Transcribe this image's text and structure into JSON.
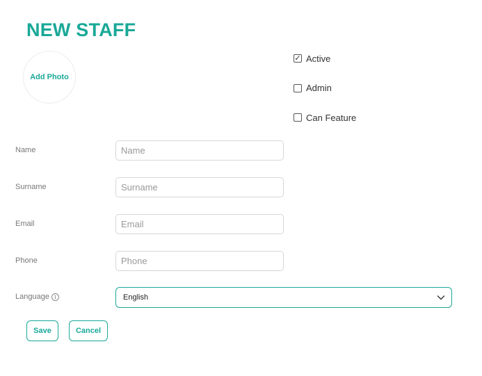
{
  "page": {
    "title": "NEW STAFF",
    "add_photo_label": "Add Photo"
  },
  "flags": [
    {
      "label": "Active",
      "checked": true,
      "mark": "✓"
    },
    {
      "label": "Admin",
      "checked": false,
      "mark": ""
    },
    {
      "label": "Can Feature",
      "checked": false,
      "mark": ""
    }
  ],
  "fields": {
    "name": {
      "label": "Name",
      "placeholder": "Name",
      "value": ""
    },
    "surname": {
      "label": "Surname",
      "placeholder": "Surname",
      "value": ""
    },
    "email": {
      "label": "Email",
      "placeholder": "Email",
      "value": ""
    },
    "phone": {
      "label": "Phone",
      "placeholder": "Phone",
      "value": ""
    },
    "language": {
      "label": "Language",
      "info_glyph": "i",
      "selected": "English"
    }
  },
  "actions": {
    "save_label": "Save",
    "cancel_label": "Cancel"
  },
  "colors": {
    "accent": "#1aa897"
  }
}
